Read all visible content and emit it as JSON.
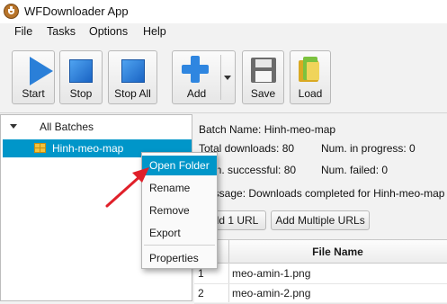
{
  "window": {
    "title": "WFDownloader App"
  },
  "menu": {
    "items": [
      "File",
      "Tasks",
      "Options",
      "Help"
    ]
  },
  "toolbar": {
    "start": "Start",
    "stop": "Stop",
    "stop_all": "Stop All",
    "add": "Add",
    "save": "Save",
    "load": "Load"
  },
  "tree": {
    "root": "All Batches",
    "child": "Hinh-meo-map"
  },
  "details": {
    "batch_name": "Batch Name:  Hinh-meo-map",
    "total_downloads": "Total downloads: 80",
    "num_in_progress": "Num. in progress: 0",
    "num_successful": "Num. successful: 80",
    "num_failed": "Num. failed: 0",
    "message": "Message:  Downloads completed for Hinh-meo-map"
  },
  "buttons": {
    "add_url": "Add 1 URL",
    "add_multiple": "Add Multiple URLs"
  },
  "table": {
    "columns": [
      "",
      "File Name"
    ],
    "rows": [
      {
        "num": "1",
        "file": "meo-amin-1.png"
      },
      {
        "num": "2",
        "file": "meo-amin-2.png"
      }
    ]
  },
  "context_menu": {
    "items": [
      "Open Folder",
      "Rename",
      "Remove",
      "Export",
      "Properties"
    ],
    "highlighted": "Open Folder"
  },
  "colors": {
    "selection": "#0096c9",
    "accent_blue": "#2a7fd8",
    "annotation_arrow": "#e0202a"
  },
  "icons": [
    "app-logo-icon",
    "play-icon",
    "stop-icon",
    "stop-all-icon",
    "plus-icon",
    "floppy-disk-icon",
    "load-folder-icon",
    "batch-grid-icon"
  ]
}
